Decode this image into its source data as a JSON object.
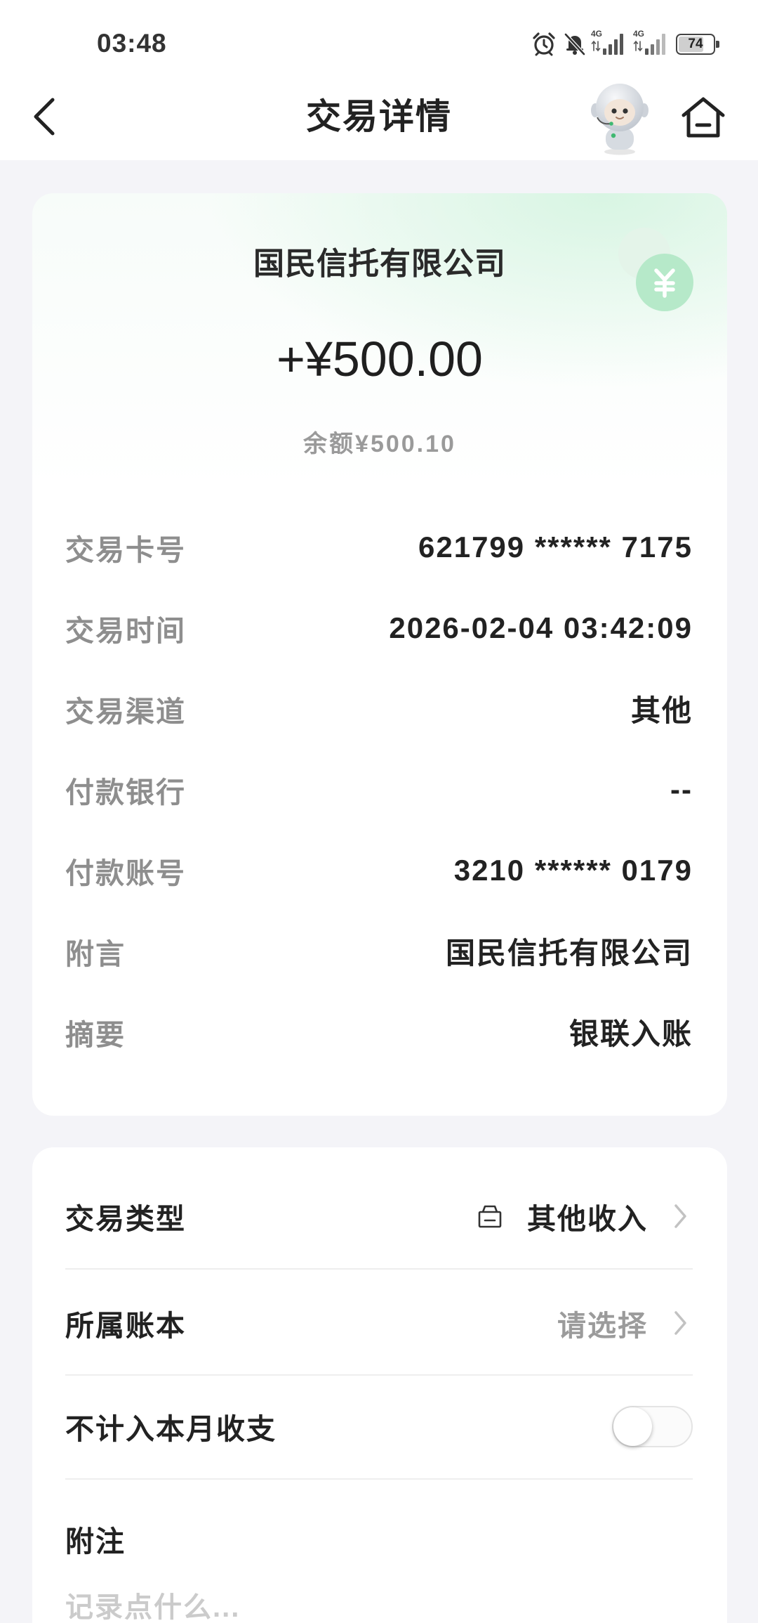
{
  "status_bar": {
    "time": "03:48",
    "network_1": "4G",
    "network_2": "4G",
    "battery": "74",
    "icons": {
      "alarm": "alarm-icon",
      "silent": "bell-off-icon",
      "signal": "signal-icon",
      "battery": "battery-icon"
    }
  },
  "header": {
    "title": "交易详情",
    "icons": {
      "back": "back-arrow-icon",
      "assistant": "robot-assistant-icon",
      "home": "home-icon"
    }
  },
  "summary": {
    "counterparty": "国民信托有限公司",
    "amount": "+¥500.00",
    "balance": "余额¥500.10",
    "icon": "yuan-coin-icon"
  },
  "details": [
    {
      "label": "交易卡号",
      "value": "621799 ****** 7175"
    },
    {
      "label": "交易时间",
      "value": "2026-02-04 03:42:09"
    },
    {
      "label": "交易渠道",
      "value": "其他"
    },
    {
      "label": "付款银行",
      "value": "--"
    },
    {
      "label": "付款账号",
      "value": "3210 ****** 0179"
    },
    {
      "label": "附言",
      "value": "国民信托有限公司"
    },
    {
      "label": "摘要",
      "value": "银联入账"
    }
  ],
  "settings": {
    "transaction_type": {
      "label": "交易类型",
      "value": "其他收入",
      "icon": "income-category-icon"
    },
    "ledger": {
      "label": "所属账本",
      "value": "请选择"
    },
    "exclude_from_month": {
      "label": "不计入本月收支",
      "enabled": false
    },
    "note": {
      "label": "附注",
      "placeholder": "记录点什么..."
    }
  },
  "colors": {
    "page_background": "#f4f4f8",
    "text_primary": "#222222",
    "text_secondary": "#8e8e8e",
    "accent_green": "#b6e9c9"
  }
}
